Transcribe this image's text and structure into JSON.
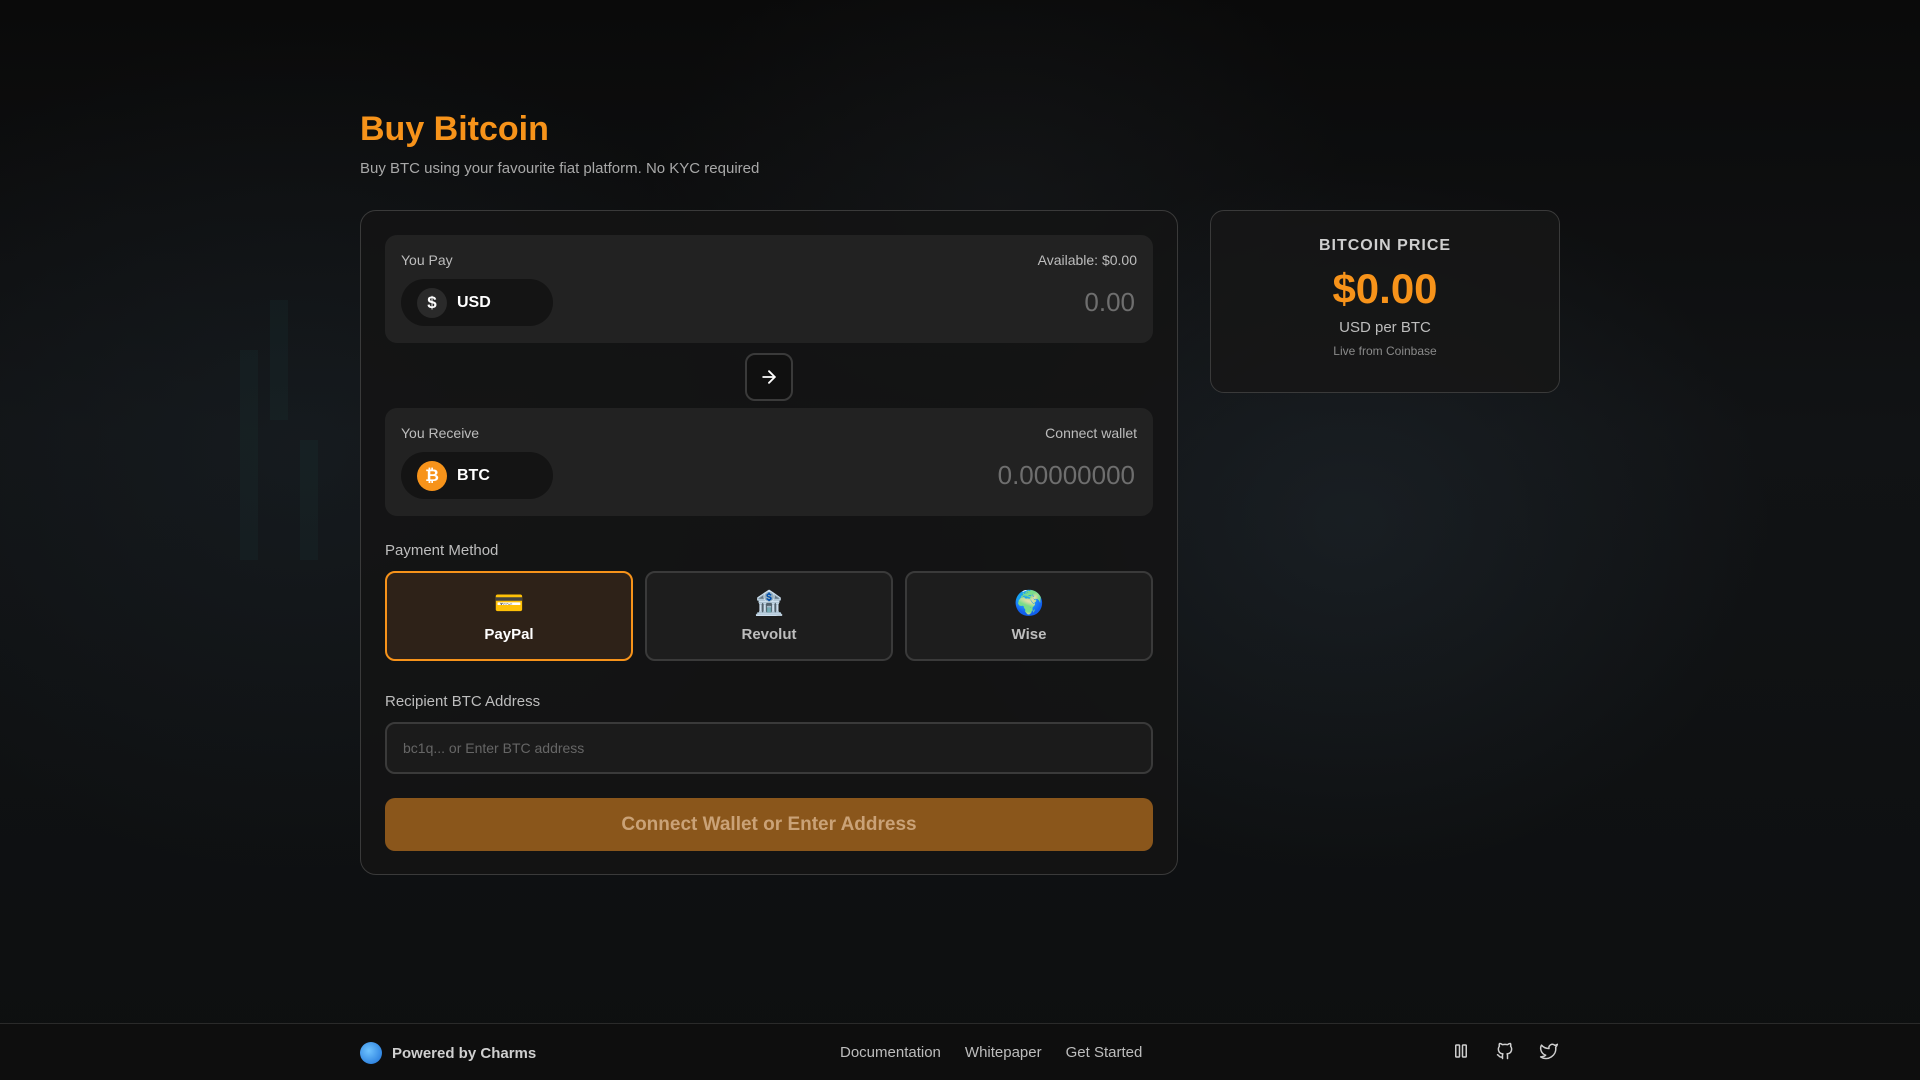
{
  "header": {
    "title": "Buy Bitcoin",
    "subtitle": "Buy BTC using your favourite fiat platform. No KYC required"
  },
  "pay": {
    "label": "You Pay",
    "available": "Available: $0.00",
    "currency_symbol": "$",
    "currency": "USD",
    "amount": "0.00"
  },
  "swap": {
    "icon": "arrow-right-icon"
  },
  "receive": {
    "label": "You Receive",
    "action": "Connect wallet",
    "currency_symbol": "₿",
    "currency": "BTC",
    "amount": "0.00000000"
  },
  "payment": {
    "label": "Payment Method",
    "methods": [
      {
        "name": "PayPal",
        "icon": "💳",
        "selected": true
      },
      {
        "name": "Revolut",
        "icon": "🏦",
        "selected": false
      },
      {
        "name": "Wise",
        "icon": "🌍",
        "selected": false
      }
    ]
  },
  "address": {
    "label": "Recipient BTC Address",
    "placeholder": "bc1q... or Enter BTC address",
    "value": ""
  },
  "cta": {
    "label": "Connect Wallet or Enter Address"
  },
  "price": {
    "title": "BITCOIN PRICE",
    "value": "$0.00",
    "unit": "USD per BTC",
    "source": "Live from Coinbase"
  },
  "footer": {
    "powered_by": "Powered by Charms",
    "links": [
      "Documentation",
      "Whitepaper",
      "Get Started"
    ],
    "icons": [
      "columns-icon",
      "github-icon",
      "twitter-icon"
    ]
  },
  "colors": {
    "accent": "#f7931a",
    "cta_bg": "#8a561b",
    "background": "#0c0c0d"
  }
}
